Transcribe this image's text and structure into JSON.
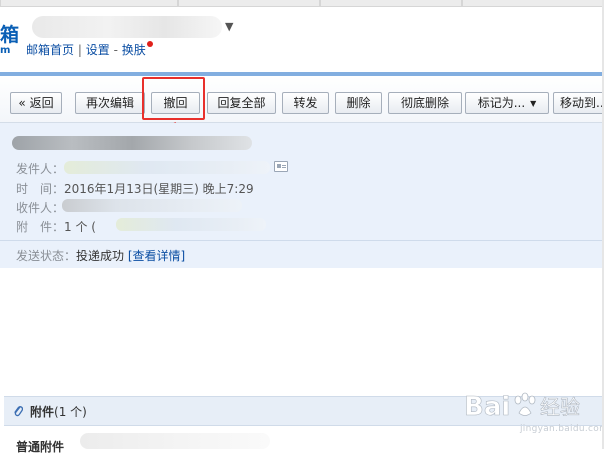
{
  "header": {
    "logo_fragment": "箱",
    "logo_sub": "m",
    "links": {
      "home": "邮箱首页",
      "settings": "设置",
      "skin": "换肤"
    },
    "separators": {
      "pipe": "|",
      "dash": "-"
    },
    "caret": "▼"
  },
  "toolbar": {
    "buttons": [
      {
        "label": "« 返回"
      },
      {
        "label": "再次编辑"
      },
      {
        "label": "撤回"
      },
      {
        "label": "回复全部"
      },
      {
        "label": "转发"
      },
      {
        "label": "删除"
      },
      {
        "label": "彻底删除"
      },
      {
        "label": "标记为..."
      },
      {
        "label": "移动到..."
      }
    ],
    "dropdown_glyph": "▼"
  },
  "message": {
    "sender_label": "发件人：",
    "time_label": "时　间：",
    "time_value": "2016年1月13日(星期三) 晚上7:29",
    "recipient_label": "收件人：",
    "attachment_label": "附　件：",
    "attachment_value": "1 个 (",
    "status_label": "发送状态：",
    "status_value": "投递成功",
    "status_link": "[查看详情]"
  },
  "attachments": {
    "title": "附件",
    "count": "(1 个)",
    "normal_label": "普通附件"
  },
  "watermark": {
    "brand": "Bai",
    "brand_end": "经验",
    "sub": "jingyan.baidu.com"
  },
  "colors": {
    "accent_blue": "#82aee0",
    "link": "#0b4ea3",
    "highlight": "#e8302c",
    "panel": "#eaf1fb"
  }
}
